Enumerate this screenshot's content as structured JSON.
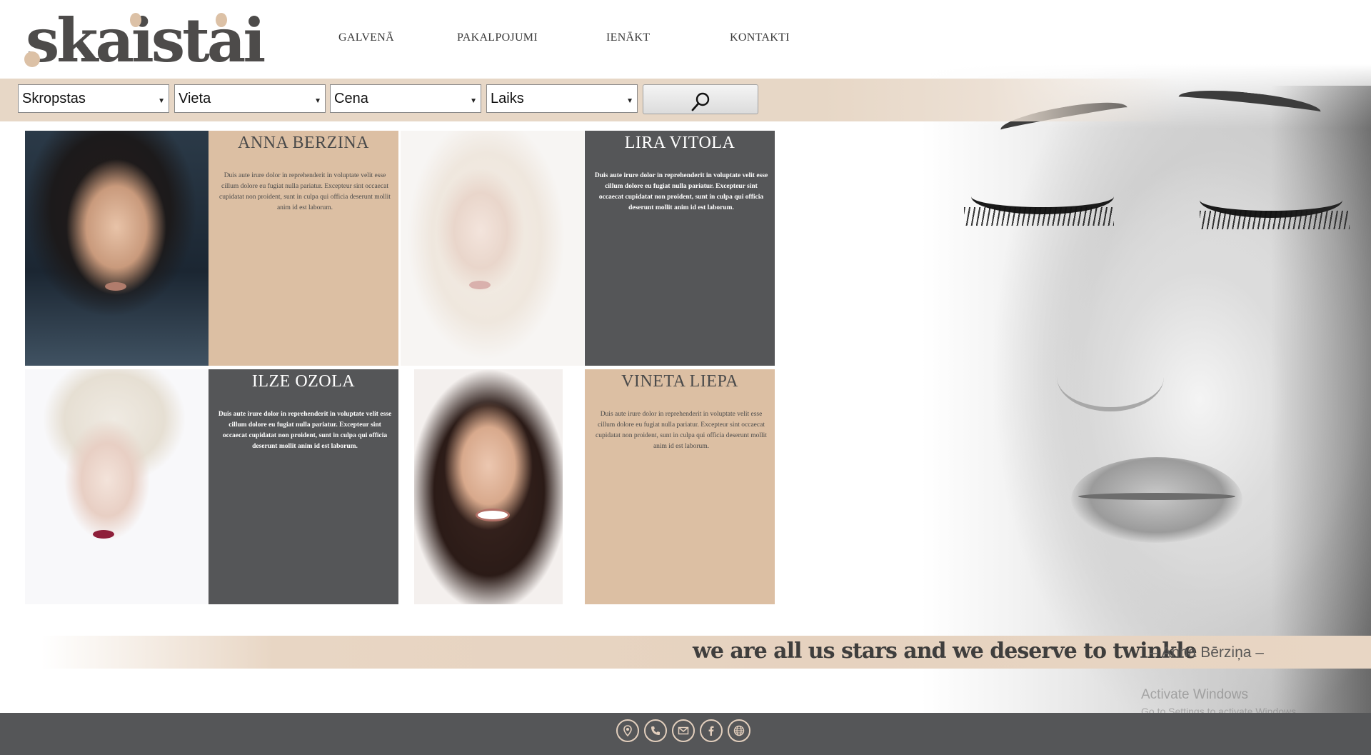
{
  "brand": {
    "logo_text": "skaistai"
  },
  "nav": {
    "items": [
      "GALVENĀ",
      "PAKALPOJUMI",
      "IENĀKT",
      "KONTAKTI"
    ]
  },
  "filters": {
    "selects": [
      {
        "value": "Skropstas"
      },
      {
        "value": "Vieta"
      },
      {
        "value": "Cena"
      },
      {
        "value": "Laiks"
      }
    ],
    "search_icon": "search-icon"
  },
  "profiles": [
    {
      "name": "ANNA BERZINA",
      "desc": "Duis aute irure dolor in reprehenderit in voluptate velit esse cillum dolore eu fugiat nulla pariatur. Excepteur sint occaecat cupidatat non proident, sunt in culpa qui officia deserunt mollit anim id est laborum.",
      "card_color": "#dcbfa3"
    },
    {
      "name": "LIRA VITOLA",
      "desc": "Duis aute irure dolor in reprehenderit in voluptate velit esse cillum dolore eu fugiat nulla pariatur. Excepteur sint occaecat cupidatat non proident, sunt in culpa qui officia deserunt mollit anim id est laborum.",
      "card_color": "#555658"
    },
    {
      "name": "ILZE OZOLA",
      "desc": "Duis aute irure dolor in reprehenderit in voluptate velit esse cillum dolore eu fugiat nulla pariatur. Excepteur sint occaecat cupidatat non proident, sunt in culpa qui officia deserunt mollit anim id est laborum.",
      "card_color": "#555658"
    },
    {
      "name": "VINETA LIEPA",
      "desc": "Duis aute irure dolor in reprehenderit in voluptate velit esse cillum dolore eu fugiat nulla pariatur. Excepteur sint occaecat cupidatat non proident, sunt in culpa qui officia deserunt mollit anim id est laborum.",
      "card_color": "#dcbfa3"
    }
  ],
  "quote": {
    "text": "we are all us stars and we deserve to twinkle",
    "author": "– Anna Bērziņa –"
  },
  "watermark": {
    "line1": "Activate Windows",
    "line2": "Go to Settings to activate Windows."
  },
  "footer": {
    "icons": [
      "location-icon",
      "phone-icon",
      "mail-icon",
      "facebook-icon",
      "globe-icon"
    ],
    "accent": "#e3cfbd"
  },
  "colors": {
    "tan": "#dcbfa3",
    "charcoal": "#555658",
    "band": "#e7d7c6"
  }
}
